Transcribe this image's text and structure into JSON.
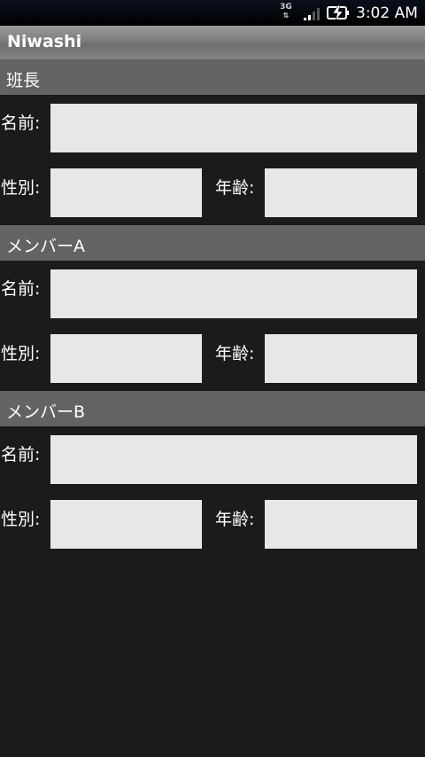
{
  "status_bar": {
    "network": "3G",
    "time": "3:02 AM"
  },
  "app": {
    "title": "Niwashi"
  },
  "sections": [
    {
      "header": "班長",
      "name_label": "名前:",
      "gender_label": "性別:",
      "age_label": "年齢:",
      "name_value": "",
      "gender_value": "",
      "age_value": ""
    },
    {
      "header": "メンバーA",
      "name_label": "名前:",
      "gender_label": "性別:",
      "age_label": "年齢:",
      "name_value": "",
      "gender_value": "",
      "age_value": ""
    },
    {
      "header": "メンバーB",
      "name_label": "名前:",
      "gender_label": "性別:",
      "age_label": "年齢:",
      "name_value": "",
      "gender_value": "",
      "age_value": ""
    }
  ],
  "colors": {
    "background": "#1b1b1b",
    "section_header": "#636363",
    "field": "#e7e7e7"
  }
}
